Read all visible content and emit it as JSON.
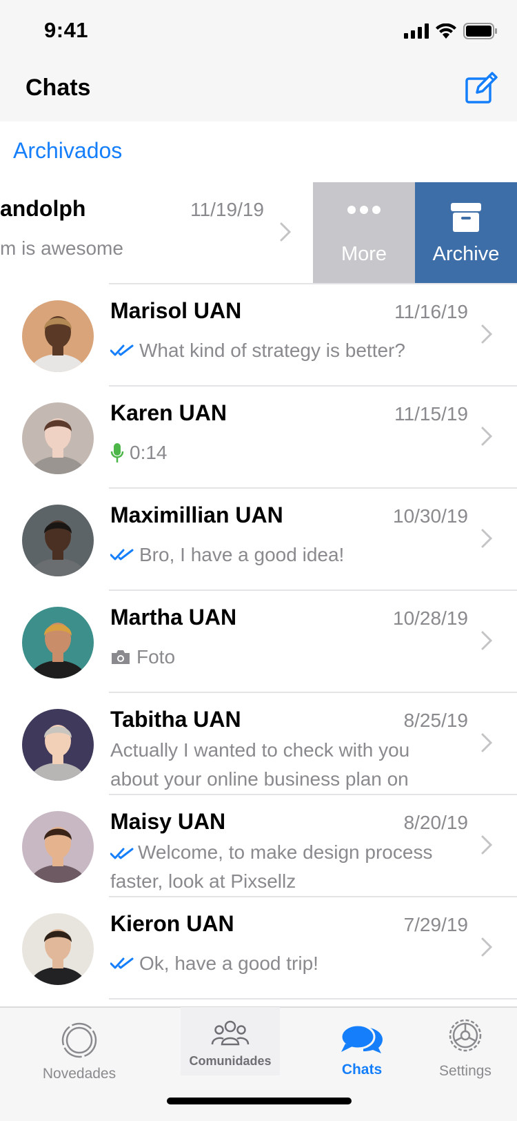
{
  "status_bar": {
    "time": "9:41"
  },
  "nav": {
    "title": "Chats"
  },
  "archived_link": "Archivados",
  "swiped_row": {
    "name": "andolph",
    "date": "11/19/19",
    "preview": "m is awesome",
    "actions": {
      "more": "More",
      "archive": "Archive"
    }
  },
  "chats": [
    {
      "name": "Marisol UAN",
      "date": "11/16/19",
      "preview": "What kind of strategy is better?",
      "status": "read",
      "avatar": {
        "bg": "#d9a47a",
        "skin": "#5a3a26",
        "cloth": "#e8e6e4",
        "hair": "#b38a55"
      }
    },
    {
      "name": "Karen UAN",
      "date": "11/15/19",
      "preview": "0:14",
      "status": "voice",
      "avatar": {
        "bg": "#c4b9b2",
        "skin": "#f0d2c4",
        "cloth": "#9a9590",
        "hair": "#5b3a2c"
      }
    },
    {
      "name": "Maximillian UAN",
      "date": "10/30/19",
      "preview": "Bro, I have a good idea!",
      "status": "read",
      "avatar": {
        "bg": "#5d6468",
        "skin": "#4a3022",
        "cloth": "#6b6e70",
        "hair": "#1a1614"
      }
    },
    {
      "name": "Martha UAN",
      "date": "10/28/19",
      "preview": "Foto",
      "status": "photo",
      "avatar": {
        "bg": "#3c8f8a",
        "skin": "#c98d6a",
        "cloth": "#1e1e1e",
        "hair": "#d8a040"
      }
    },
    {
      "name": "Tabitha UAN",
      "date": "8/25/19",
      "preview": "Actually I wanted to check with you about your online business plan on",
      "status": "none",
      "avatar": {
        "bg": "#3f3a5c",
        "skin": "#f2d0b8",
        "cloth": "#b8b6b4",
        "hair": "#c8c4be"
      }
    },
    {
      "name": "Maisy UAN",
      "date": "8/20/19",
      "preview": "Welcome, to make design process faster, look at Pixsellz",
      "status": "read",
      "avatar": {
        "bg": "#c8b8c4",
        "skin": "#e5b48f",
        "cloth": "#6d5a62",
        "hair": "#3a2418"
      }
    },
    {
      "name": "Kieron UAN",
      "date": "7/29/19",
      "preview": "Ok, have a good trip!",
      "status": "read",
      "avatar": {
        "bg": "#e8e4de",
        "skin": "#e2b89a",
        "cloth": "#222224",
        "hair": "#2e2218"
      }
    }
  ],
  "tabs": [
    {
      "label": "Novedades",
      "icon": "status-icon"
    },
    {
      "label": "Comunidades",
      "icon": "communities-icon"
    },
    {
      "label": "Chats",
      "icon": "chats-icon"
    },
    {
      "label": "Settings",
      "icon": "gear-icon"
    }
  ],
  "colors": {
    "accent": "#147efb",
    "archive": "#3e6ea8",
    "more": "#c6c6cb",
    "voice": "#4cb748"
  }
}
